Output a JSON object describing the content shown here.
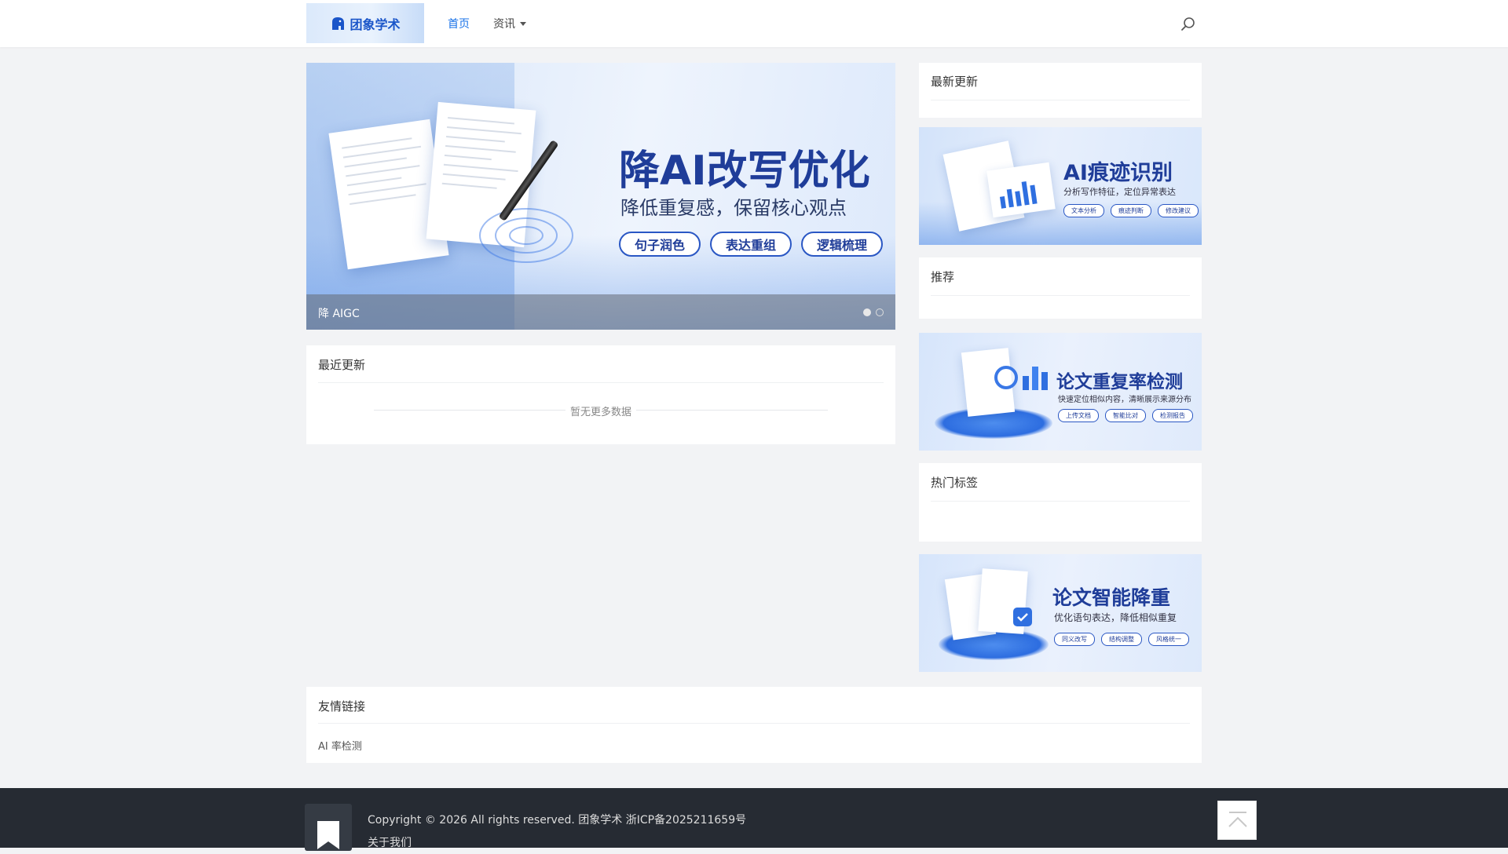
{
  "header": {
    "logo_text": "团象学术",
    "nav": [
      {
        "label": "首页",
        "active": true
      },
      {
        "label": "资讯",
        "active": false
      }
    ]
  },
  "banner": {
    "title": "降AI改写优化",
    "subtitle": "降低重复感，保留核心观点",
    "pills": [
      "句子润色",
      "表达重组",
      "逻辑梳理"
    ],
    "caption": "降 AIGC",
    "slide_count": 2,
    "active_slide": 1
  },
  "recent": {
    "title": "最近更新",
    "empty_text": "暂无更多数据"
  },
  "sidebar": {
    "latest_title": "最新更新",
    "ad1": {
      "title": "AI痕迹识别",
      "subtitle": "分析写作特征，定位异常表达",
      "tags": [
        "文本分析",
        "痕迹判断",
        "修改建议"
      ]
    },
    "recommend_title": "推荐",
    "ad2": {
      "title": "论文重复率检测",
      "subtitle": "快速定位相似内容，清晰展示来源分布",
      "tags": [
        "上传文档",
        "智能比对",
        "检测报告"
      ]
    },
    "hot_tags_title": "热门标签",
    "ad3": {
      "title": "论文智能降重",
      "subtitle": "优化语句表达，降低相似重复",
      "tags": [
        "同义改写",
        "结构调整",
        "风格统一"
      ]
    }
  },
  "friend_links": {
    "title": "友情链接",
    "items": [
      "AI 率检测"
    ]
  },
  "footer": {
    "copyright": "Copyright © 2026 All rights reserved. 团象学术 浙ICP备2025211659号",
    "about": "关于我们"
  },
  "colors": {
    "accent": "#1a73e8",
    "brand_dark": "#1f3d99",
    "footer_bg": "#262b33",
    "page_bg": "#f2f3f5"
  }
}
